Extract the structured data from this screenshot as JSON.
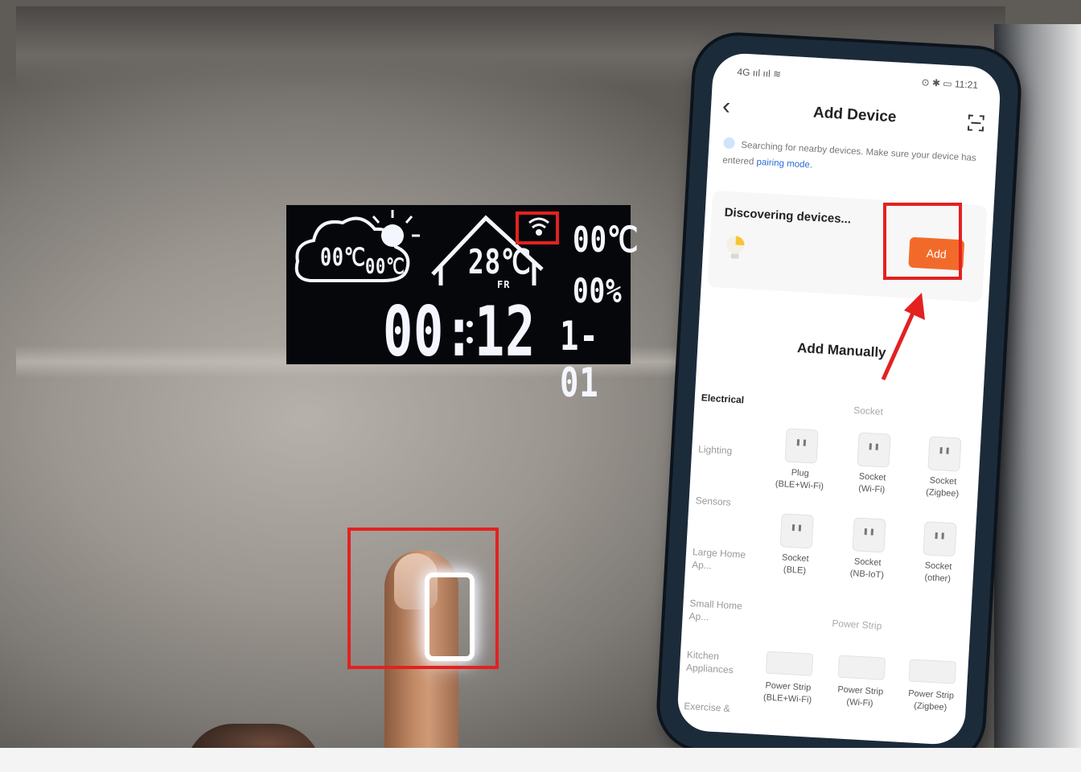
{
  "led_display": {
    "cloud_temp_1": "00℃",
    "cloud_temp_2": "00℃",
    "indoor_temp": "28℃",
    "day": "FR",
    "outdoor_temp": "00℃",
    "humidity": "00%",
    "clock": "00:12",
    "date": "1-01"
  },
  "phone": {
    "status_left": "4G ııl ııl ≋",
    "status_right": "⊙ ✱ ▭ 11:21",
    "title": "Add Device",
    "hint_text": "Searching for nearby devices. Make sure your device has entered",
    "hint_link": "pairing mode.",
    "discovering_label": "Discovering devices...",
    "add_button": "Add",
    "add_manually": "Add Manually",
    "categories": [
      "Electrical",
      "Lighting",
      "Sensors",
      "Large Home Ap...",
      "Small Home Ap...",
      "Kitchen Appliances",
      "Exercise &"
    ],
    "section_socket": "Socket",
    "section_power_strip": "Power Strip",
    "devices_row1": [
      {
        "name": "Plug",
        "sub": "(BLE+Wi-Fi)"
      },
      {
        "name": "Socket",
        "sub": "(Wi-Fi)"
      },
      {
        "name": "Socket",
        "sub": "(Zigbee)"
      }
    ],
    "devices_row2": [
      {
        "name": "Socket",
        "sub": "(BLE)"
      },
      {
        "name": "Socket",
        "sub": "(NB-IoT)"
      },
      {
        "name": "Socket",
        "sub": "(other)"
      }
    ],
    "devices_row3": [
      {
        "name": "Power Strip",
        "sub": "(BLE+Wi-Fi)"
      },
      {
        "name": "Power Strip",
        "sub": "(Wi-Fi)"
      },
      {
        "name": "Power Strip",
        "sub": "(Zigbee)"
      }
    ]
  },
  "colors": {
    "highlight_red": "#e32121",
    "add_orange": "#f26a2a",
    "led_white": "#f4f6ff",
    "phone_frame": "#1c2b3a"
  }
}
